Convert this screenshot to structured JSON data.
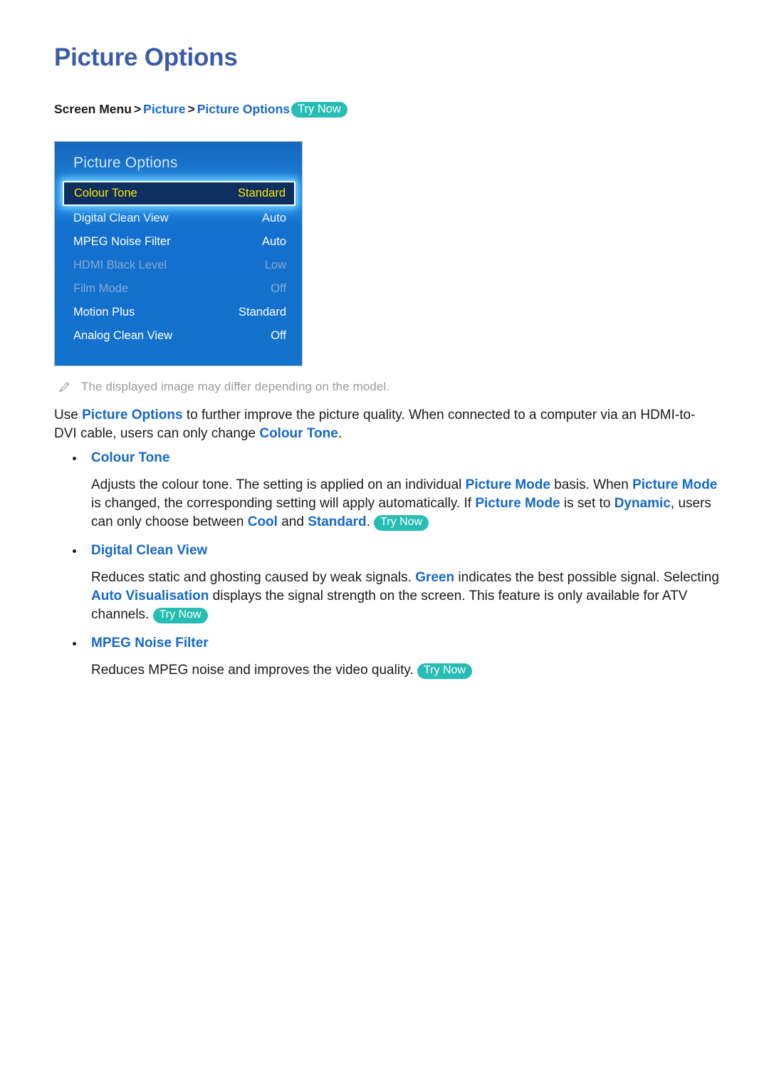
{
  "page": {
    "title": "Picture Options"
  },
  "breadcrumb": {
    "root": "Screen Menu",
    "sep": ">",
    "level1": "Picture",
    "level2": "Picture Options",
    "try_now": "Try Now"
  },
  "osd": {
    "header": "Picture Options",
    "rows": [
      {
        "label": "Colour Tone",
        "value": "Standard",
        "state": "selected"
      },
      {
        "label": "Digital Clean View",
        "value": "Auto",
        "state": "enabled"
      },
      {
        "label": "MPEG Noise Filter",
        "value": "Auto",
        "state": "enabled"
      },
      {
        "label": "HDMI Black Level",
        "value": "Low",
        "state": "disabled"
      },
      {
        "label": "Film Mode",
        "value": "Off",
        "state": "disabled"
      },
      {
        "label": "Motion Plus",
        "value": "Standard",
        "state": "enabled"
      },
      {
        "label": "Analog Clean View",
        "value": "Off",
        "state": "enabled"
      }
    ]
  },
  "note": {
    "icon": "pencil-icon",
    "text": "The displayed image may differ depending on the model."
  },
  "intro": {
    "t1": "Use ",
    "kw1": "Picture Options",
    "t2": " to further improve the picture quality. When connected to a computer via an HDMI-to-DVI cable, users can only change ",
    "kw2": "Colour Tone",
    "t3": "."
  },
  "sections": [
    {
      "heading": "Colour Tone",
      "body": {
        "t1": "Adjusts the colour tone. The setting is applied on an individual ",
        "kw1": "Picture Mode",
        "t2": " basis. When ",
        "kw2": "Picture Mode",
        "t3": " is changed, the corresponding setting will apply automatically. If ",
        "kw3": "Picture Mode",
        "t4": " is set to ",
        "kw4": "Dynamic",
        "t5": ", users can only choose between ",
        "kw5": "Cool",
        "t6": " and ",
        "kw6": "Standard",
        "t7": ". ",
        "try_now": "Try Now"
      }
    },
    {
      "heading": "Digital Clean View",
      "body": {
        "t1": "Reduces static and ghosting caused by weak signals. ",
        "kw1": "Green",
        "t2": " indicates the best possible signal. Selecting ",
        "kw2": "Auto Visualisation",
        "t3": " displays the signal strength on the screen. This feature is only available for ATV channels. ",
        "try_now": "Try Now"
      }
    },
    {
      "heading": "MPEG Noise Filter",
      "body": {
        "t1": "Reduces MPEG noise and improves the video quality. ",
        "try_now": "Try Now"
      }
    }
  ],
  "colors": {
    "title_blue": "#3b5ba9",
    "link_blue": "#1668c8",
    "try_now_teal": "#27bdb4",
    "osd_blue": "#1272cc",
    "osd_selected_bg": "#0d3060",
    "osd_selected_text": "#ffe400",
    "osd_disabled_text": "#86a8cf",
    "note_gray": "#9a9a9a"
  }
}
